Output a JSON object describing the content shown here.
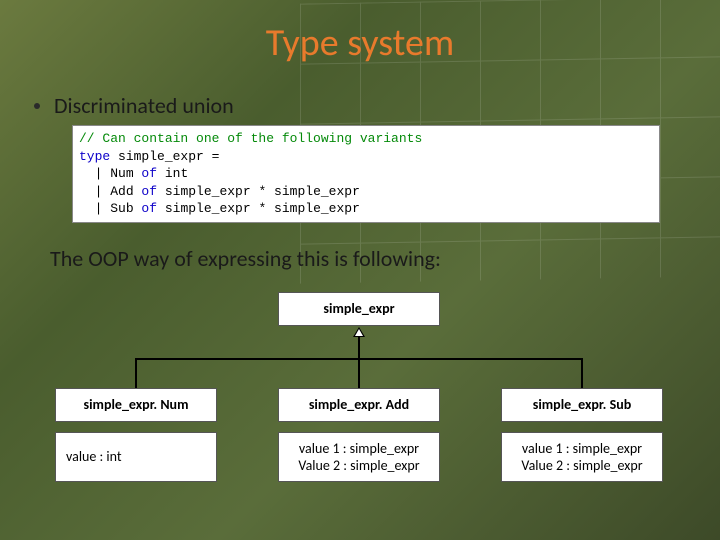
{
  "title": "Type system",
  "bullet": "Discriminated union",
  "code": {
    "comment": "// Can contain one of the following variants",
    "line2_kw1": "type",
    "line2_rest": " simple_expr =",
    "line3_pipe": "  | ",
    "line3_ctor": "Num",
    "line3_of": " of ",
    "line3_type": "int",
    "line4_pipe": "  | ",
    "line4_ctor": "Add",
    "line4_of": " of ",
    "line4_type": "simple_expr * simple_expr",
    "line5_pipe": "  | ",
    "line5_ctor": "Sub",
    "line5_of": " of ",
    "line5_type": "simple_expr * simple_expr"
  },
  "sentence": "The OOP way of expressing this is following:",
  "diagram": {
    "root": "simple_expr",
    "num_title": "simple_expr. Num",
    "num_body": "value : int",
    "add_title": "simple_expr. Add",
    "add_body": "value 1 : simple_expr\nValue 2 : simple_expr",
    "sub_title": "simple_expr. Sub",
    "sub_body": "value 1 : simple_expr\nValue 2 : simple_expr"
  }
}
